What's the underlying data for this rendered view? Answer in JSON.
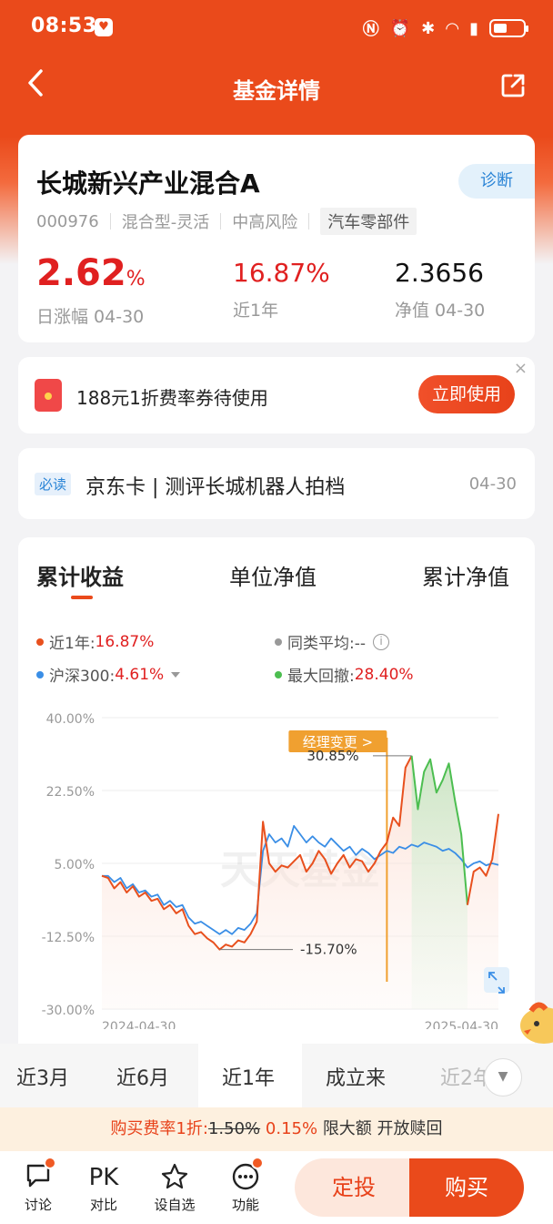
{
  "status_bar": {
    "time": "08:53",
    "badge": "♥"
  },
  "nav": {
    "title": "基金详情"
  },
  "fund": {
    "name": "长城新兴产业混合A",
    "diagnose": "诊断",
    "code": "000976",
    "type": "混合型-灵活",
    "risk": "中高风险",
    "sector": "汽车零部件",
    "daily_change_num": "2.62",
    "daily_change_unit": "%",
    "daily_change_label": "日涨幅 04-30",
    "year_return": "16.87%",
    "year_return_label": "近1年",
    "nav_value": "2.3656",
    "nav_label": "净值 04-30"
  },
  "coupon": {
    "text": "188元1折费率券待使用",
    "button": "立即使用",
    "close": "×"
  },
  "news": {
    "tag": "必读",
    "title": "京东卡 | 测评长城机器人拍档",
    "date": "04-30"
  },
  "chart_tabs": [
    "累计收益",
    "单位净值",
    "累计净值"
  ],
  "legend": {
    "fund_label": "近1年:",
    "fund_value": "16.87%",
    "peer_label": "同类平均:--",
    "index_label": "沪深300:",
    "index_value": "4.61%",
    "drawdown_label": "最大回撤:",
    "drawdown_value": "28.40%"
  },
  "colors": {
    "fund": "#e8501e",
    "index": "#3a8ee6",
    "peer": "#999999",
    "drawdown": "#4cbe50"
  },
  "chart_data": {
    "type": "line",
    "y_ticks": [
      "40.00%",
      "22.50%",
      "5.00%",
      "-12.50%",
      "-30.00%"
    ],
    "x_ticks": [
      "2024-04-30",
      "2025-04-30"
    ],
    "ylim": [
      -30,
      40
    ],
    "watermark": "天天基金",
    "annotations": {
      "manager_change": "经理变更 >",
      "max_label": "30.85%",
      "min_label": "-15.70%"
    },
    "series": [
      {
        "name": "近1年",
        "values": [
          2.0,
          1.5,
          -1.0,
          0.5,
          -2.0,
          -0.5,
          -3.0,
          -2.0,
          -4.0,
          -3.5,
          -6.0,
          -5.0,
          -7.0,
          -6.0,
          -10.0,
          -12.0,
          -11.5,
          -13.0,
          -14.0,
          -15.7,
          -14.5,
          -15.0,
          -13.5,
          -14.0,
          -12.0,
          -9.0,
          15.0,
          5.0,
          3.0,
          4.5,
          4.0,
          5.5,
          7.0,
          3.0,
          5.0,
          8.0,
          6.0,
          2.5,
          5.0,
          7.0,
          4.0,
          6.0,
          5.5,
          3.0,
          5.0,
          8.0,
          10.0,
          16.0,
          14.0,
          28.0,
          30.85,
          18.0,
          27.0,
          30.0,
          22.0,
          25.0,
          29.0,
          20.0,
          12.0,
          -5.0,
          3.0,
          4.0,
          2.0,
          6.0,
          16.87
        ]
      },
      {
        "name": "沪深300",
        "values": [
          2.0,
          2.0,
          0.5,
          1.5,
          -1.0,
          0.0,
          -2.0,
          -1.5,
          -3.0,
          -2.5,
          -5.0,
          -4.0,
          -5.5,
          -5.0,
          -8.0,
          -9.5,
          -9.0,
          -10.0,
          -11.0,
          -12.0,
          -11.0,
          -12.0,
          -10.5,
          -11.0,
          -9.5,
          -7.0,
          8.0,
          12.0,
          10.0,
          11.0,
          9.0,
          14.0,
          12.0,
          10.0,
          11.5,
          10.0,
          9.0,
          11.0,
          9.5,
          8.0,
          9.0,
          7.0,
          8.5,
          7.5,
          6.0,
          7.0,
          8.0,
          7.5,
          9.0,
          8.5,
          9.5,
          9.0,
          10.0,
          9.5,
          9.0,
          8.0,
          8.5,
          7.5,
          6.0,
          4.0,
          5.0,
          5.5,
          4.5,
          5.0,
          4.61
        ]
      }
    ]
  },
  "range_tabs": [
    "近3月",
    "近6月",
    "近1年",
    "成立来",
    "近2年"
  ],
  "range_active": "近1年",
  "fee": {
    "prefix": "购买费率1折:",
    "old": "1.50%",
    "new": "0.15%",
    "suffix": "限大额 开放赎回"
  },
  "bottom": {
    "tools": [
      {
        "label": "讨论",
        "icon": "chat-icon"
      },
      {
        "label": "对比",
        "icon": "PK"
      },
      {
        "label": "设自选",
        "icon": "star-icon"
      },
      {
        "label": "功能",
        "icon": "more-icon"
      }
    ],
    "dingtou": "定投",
    "buy": "购买"
  }
}
